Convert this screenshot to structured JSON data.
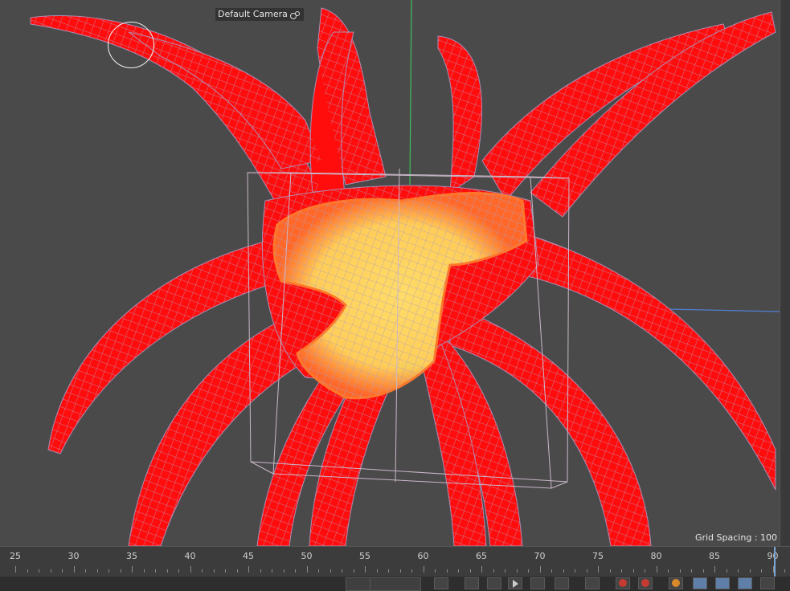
{
  "viewport": {
    "camera_label": "Default Camera",
    "grid_spacing": "Grid Spacing : 100"
  },
  "timeline": {
    "ticks": [
      "25",
      "30",
      "35",
      "40",
      "45",
      "50",
      "55",
      "60",
      "65",
      "70",
      "75",
      "80",
      "85",
      "90"
    ]
  },
  "colors": {
    "mesh_red": "#ff0d0d",
    "highlight_yellow": "#ffe36b",
    "wire": "#9b8fb0",
    "viewport_bg": "#4a4a4a"
  }
}
